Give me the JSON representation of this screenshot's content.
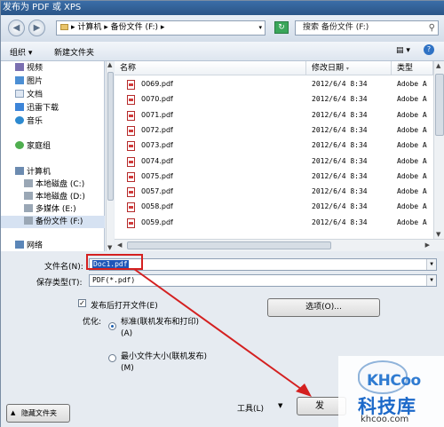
{
  "window": {
    "title": "发布为 PDF 或 XPS"
  },
  "address": {
    "path": "▸ 计算机 ▸ 备份文件 (F:) ▸",
    "search_placeholder": "搜索 备份文件 (F:)"
  },
  "toolbar": {
    "organize": "组织 ▾",
    "new_folder": "新建文件夹"
  },
  "nav": {
    "items": [
      {
        "label": "视频",
        "icon": "video-icon"
      },
      {
        "label": "图片",
        "icon": "pictures-icon"
      },
      {
        "label": "文档",
        "icon": "documents-icon"
      },
      {
        "label": "迅雷下载",
        "icon": "download-icon"
      },
      {
        "label": "音乐",
        "icon": "music-icon"
      },
      {
        "label": "家庭组",
        "icon": "homegroup-icon"
      },
      {
        "label": "计算机",
        "icon": "computer-icon"
      },
      {
        "label": "本地磁盘 (C:)",
        "icon": "drive-icon"
      },
      {
        "label": "本地磁盘 (D:)",
        "icon": "drive-icon"
      },
      {
        "label": "多媒体 (E:)",
        "icon": "drive-icon"
      },
      {
        "label": "备份文件 (F:)",
        "icon": "drive-icon"
      },
      {
        "label": "网络",
        "icon": "network-icon"
      }
    ]
  },
  "columns": {
    "name": "名称",
    "date": "修改日期",
    "type": "类型"
  },
  "files": [
    {
      "name": "0069.pdf",
      "date": "2012/6/4 8:34",
      "type": "Adobe A"
    },
    {
      "name": "0070.pdf",
      "date": "2012/6/4 8:34",
      "type": "Adobe A"
    },
    {
      "name": "0071.pdf",
      "date": "2012/6/4 8:34",
      "type": "Adobe A"
    },
    {
      "name": "0072.pdf",
      "date": "2012/6/4 8:34",
      "type": "Adobe A"
    },
    {
      "name": "0073.pdf",
      "date": "2012/6/4 8:34",
      "type": "Adobe A"
    },
    {
      "name": "0074.pdf",
      "date": "2012/6/4 8:34",
      "type": "Adobe A"
    },
    {
      "name": "0075.pdf",
      "date": "2012/6/4 8:34",
      "type": "Adobe A"
    },
    {
      "name": "0057.pdf",
      "date": "2012/6/4 8:34",
      "type": "Adobe A"
    },
    {
      "name": "0058.pdf",
      "date": "2012/6/4 8:34",
      "type": "Adobe A"
    },
    {
      "name": "0059.pdf",
      "date": "2012/6/4 8:34",
      "type": "Adobe A"
    }
  ],
  "form": {
    "filename_label": "文件名(N):",
    "filename_value": "Doc1.pdf",
    "filetype_label": "保存类型(T):",
    "filetype_value": "PDF(*.pdf)",
    "open_after_label": "发布后打开文件(E)",
    "open_after_mark": "✓",
    "optimize_label": "优化:",
    "opt_standard": "标准(联机发布和打印)(A)",
    "opt_min": "最小文件大小(联机发布)(M)",
    "options_button": "选项(O)...",
    "hide_folders": "隐藏文件夹",
    "tools": "工具(L)",
    "publish": "发"
  },
  "watermark": {
    "badge": "KHCoo",
    "name": "科技库",
    "url": "khcoo.com"
  },
  "colors": {
    "arrow": "#d42020",
    "selection": "#1e56b8",
    "brand": "#1c69c9"
  }
}
